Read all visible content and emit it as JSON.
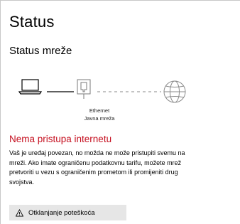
{
  "page": {
    "title": "Status",
    "section_title": "Status mreže"
  },
  "network": {
    "adapter_label": "Ethernet",
    "network_type": "Javna mreža",
    "devices": [
      "laptop-icon",
      "router-icon",
      "globe-icon"
    ]
  },
  "status": {
    "error_title": "Nema pristupa internetu",
    "error_color": "#c50f1f",
    "description_lines": [
      "Vaš je uređaj povezan, no možda ne može pristupiti svemu na",
      "mreži. Ako imate ograničenu podatkovnu tarifu, možete mrež",
      "pretvoriti u vezu s ograničenim prometom ili promijeniti drug",
      "svojstva."
    ]
  },
  "actions": {
    "troubleshoot_label": "Otklanjanje poteškoća",
    "troubleshoot_icon": "warning-icon"
  }
}
